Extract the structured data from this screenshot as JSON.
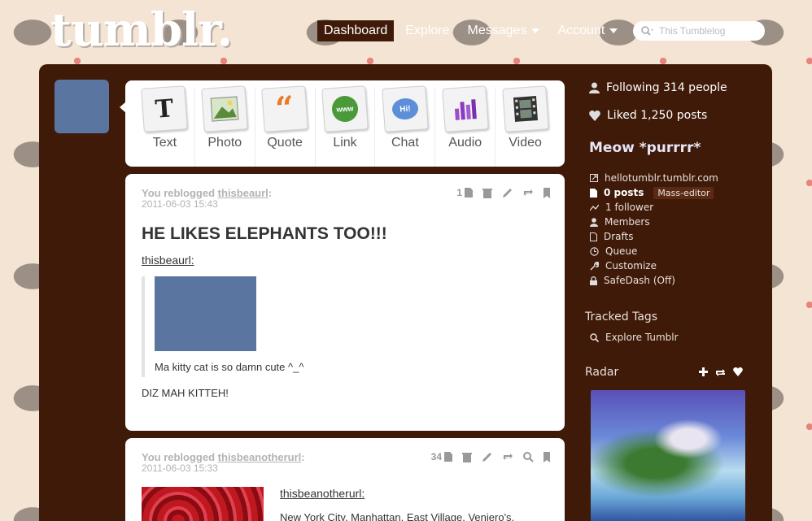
{
  "brand": {
    "logo_text": "tumblr."
  },
  "nav": {
    "items": [
      {
        "label": "Dashboard",
        "active": true
      },
      {
        "label": "Explore",
        "active": false
      },
      {
        "label": "Messages",
        "active": false
      },
      {
        "label": "Account",
        "active": false
      }
    ]
  },
  "search": {
    "placeholder": "This Tumblelog"
  },
  "post_types": [
    {
      "label": "Text",
      "icon": "text-icon",
      "glyph": "T"
    },
    {
      "label": "Photo",
      "icon": "photo-icon",
      "glyph": ""
    },
    {
      "label": "Quote",
      "icon": "quote-icon",
      "glyph": "“"
    },
    {
      "label": "Link",
      "icon": "link-icon",
      "glyph": "www"
    },
    {
      "label": "Chat",
      "icon": "chat-icon",
      "glyph": "Hi!"
    },
    {
      "label": "Audio",
      "icon": "audio-icon",
      "glyph": ""
    },
    {
      "label": "Video",
      "icon": "video-icon",
      "glyph": ""
    }
  ],
  "posts": [
    {
      "reblog_prefix": "You reblogged",
      "reblog_source": "thisbeaurl",
      "date": "2011-06-03 15:43",
      "note_count": "1",
      "title": "HE LIKES ELEPHANTS TOO!!!",
      "source_name": "thisbeaurl",
      "quote_text": "Ma kitty cat is so damn cute ^_^",
      "body": "DIZ MAH KITTEH!"
    },
    {
      "reblog_prefix": "You reblogged",
      "reblog_source": "thisbeanotherurl",
      "date": "2011-06-03 15:33",
      "note_count": "34",
      "source_name": "thisbeanotherurl",
      "body": "New York City, Manhattan, East Village, Veniero's,"
    }
  ],
  "sidebar": {
    "following": "Following 314 people",
    "liked": "Liked 1,250 posts",
    "blog_name": "Meow *purrrr*",
    "blog_links": [
      {
        "label": "hellotumblr.tumblr.com",
        "icon": "external-link-icon"
      },
      {
        "label": "0 posts",
        "icon": "document-icon",
        "badge": "Mass-editor"
      },
      {
        "label": "1 follower",
        "icon": "activity-icon"
      },
      {
        "label": "Members",
        "icon": "person-icon"
      },
      {
        "label": "Drafts",
        "icon": "document-icon"
      },
      {
        "label": "Queue",
        "icon": "clock-icon"
      },
      {
        "label": "Customize",
        "icon": "wrench-icon"
      },
      {
        "label": "SafeDash (Off)",
        "icon": "lock-icon"
      }
    ],
    "tracked_tags_heading": "Tracked Tags",
    "explore_link": "Explore Tumblr",
    "radar_heading": "Radar"
  },
  "colors": {
    "panel": "#3f1a08",
    "avatar": "#5a76a0",
    "nav_active": "#3f1a08",
    "background": "#f4e4d4"
  }
}
